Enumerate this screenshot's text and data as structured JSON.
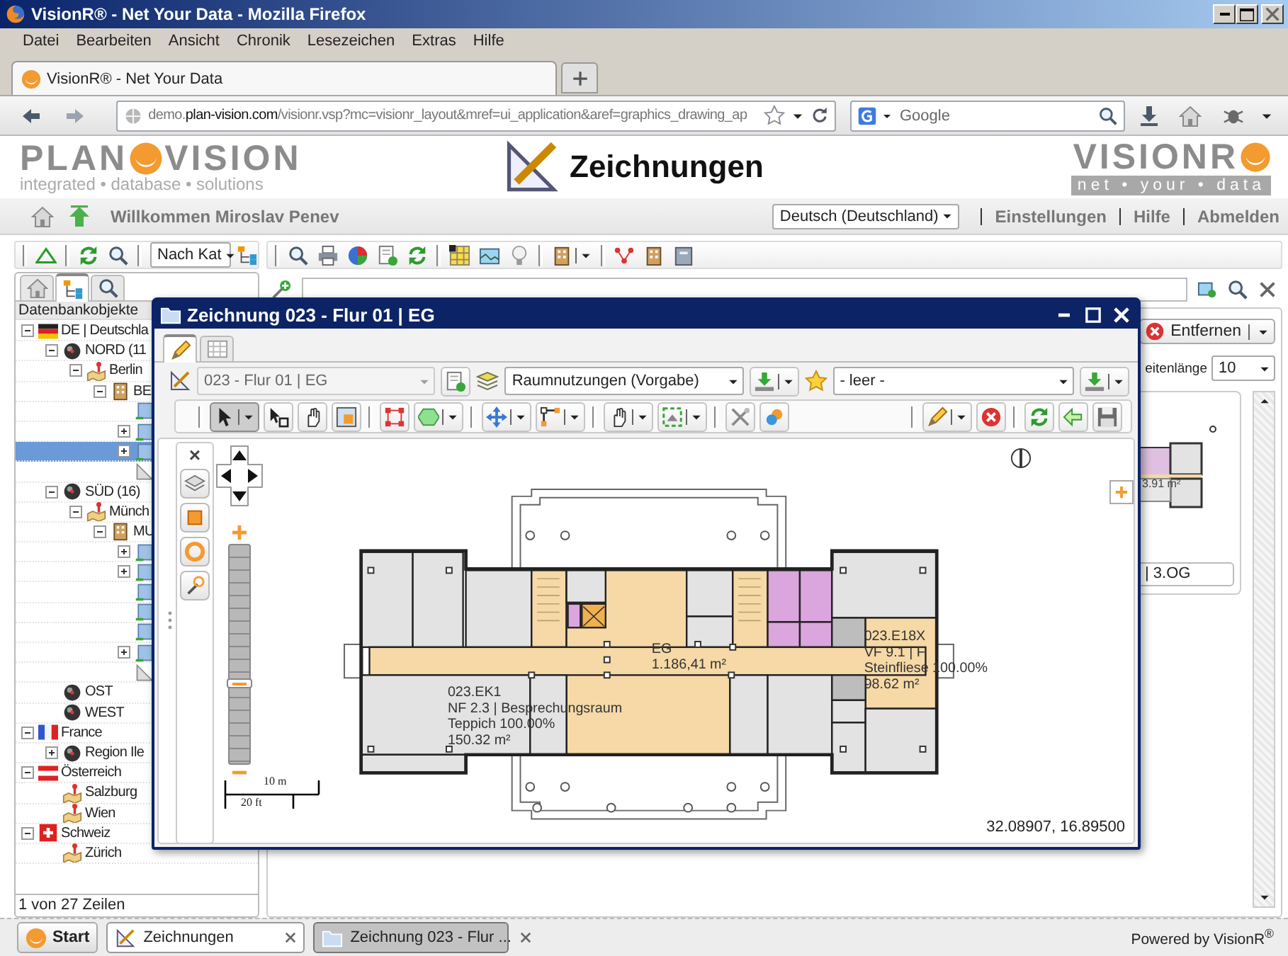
{
  "window": {
    "title": "VisionR® - Net Your Data - Mozilla Firefox"
  },
  "menu": [
    "Datei",
    "Bearbeiten",
    "Ansicht",
    "Chronik",
    "Lesezeichen",
    "Extras",
    "Hilfe"
  ],
  "browser_tabs": [
    {
      "label": "VisionR® - Net Your Data",
      "selected": true
    }
  ],
  "navigation": {
    "back_disabled": false,
    "forward_disabled": true
  },
  "address_bar": {
    "value": "demo.**plan-vision.com**/visionr.vsp?mc=visionr_layout&mref=ui_application&aref=graphics_drawing_ap"
  },
  "search_bar": {
    "placeholder": "Google"
  },
  "app_header": {
    "logo_left": {
      "part1": "PLAN",
      "part2": "VISION",
      "tagline": "integrated • database • solutions"
    },
    "title": "Zeichnungen",
    "logo_right": {
      "name": "VISIONR",
      "tagline": "net • your • data"
    }
  },
  "user_bar": {
    "welcome": "Willkommen Miroslav Penev",
    "language": "Deutsch (Deutschland)",
    "links": [
      "Einstellungen",
      "Hilfe",
      "Abmelden"
    ]
  },
  "left_panel": {
    "filter": "Nach Kat",
    "tabs": [
      {
        "kind": "home",
        "selected": false
      },
      {
        "kind": "tree",
        "selected": true
      },
      {
        "kind": "search",
        "selected": false
      }
    ],
    "header": "Datenbankobjekte",
    "tree": [
      {
        "label": "DE | Deutschla",
        "kind": "flag_de",
        "expanded": true,
        "selected": false,
        "children": [
          {
            "label": "NORD (11",
            "kind": "region",
            "expanded": true,
            "selected": false,
            "children": [
              {
                "label": "Berlin",
                "kind": "city",
                "expanded": true,
                "selected": false,
                "children": [
                  {
                    "label": "BE",
                    "kind": "building",
                    "expanded": true,
                    "selected": false,
                    "children": [
                      {
                        "kind": "floor",
                        "selected": false
                      },
                      {
                        "kind": "floor",
                        "expanded": false,
                        "selected": false
                      },
                      {
                        "kind": "floor",
                        "expanded": false,
                        "selected": true
                      },
                      {
                        "kind": "drawing",
                        "selected": false
                      }
                    ]
                  }
                ]
              }
            ]
          },
          {
            "label": "SÜD (16)",
            "kind": "region",
            "expanded": true,
            "selected": false,
            "children": [
              {
                "label": "Münch",
                "kind": "city",
                "expanded": true,
                "selected": false,
                "children": [
                  {
                    "label": "MU",
                    "kind": "building",
                    "expanded": true,
                    "selected": false,
                    "children": [
                      {
                        "kind": "floor",
                        "expanded": false,
                        "selected": false
                      },
                      {
                        "kind": "floor",
                        "expanded": false,
                        "selected": false
                      },
                      {
                        "kind": "floor",
                        "selected": false
                      },
                      {
                        "kind": "floor",
                        "selected": false
                      },
                      {
                        "kind": "floor",
                        "selected": false
                      },
                      {
                        "kind": "floor",
                        "expanded": false,
                        "selected": false
                      },
                      {
                        "kind": "drawing",
                        "selected": false
                      }
                    ]
                  }
                ]
              }
            ]
          },
          {
            "label": "OST",
            "kind": "region",
            "selected": false
          },
          {
            "label": "WEST",
            "kind": "region",
            "selected": false
          }
        ]
      },
      {
        "label": "France",
        "kind": "flag_fr",
        "expanded": true,
        "selected": false,
        "children": [
          {
            "label": "Region Ile",
            "kind": "region",
            "expanded": false,
            "selected": false
          }
        ]
      },
      {
        "label": "Österreich",
        "kind": "flag_at",
        "expanded": true,
        "selected": false,
        "children": [
          {
            "label": "Salzburg",
            "kind": "city",
            "selected": false
          },
          {
            "label": "Wien",
            "kind": "city",
            "selected": false
          }
        ]
      },
      {
        "label": "Schweiz",
        "kind": "flag_ch",
        "expanded": true,
        "selected": false,
        "children": [
          {
            "label": "Zürich",
            "kind": "city",
            "selected": false
          }
        ]
      }
    ],
    "footer": "1 von 27 Zeilen"
  },
  "right_panel": {
    "remove_button": "Entfernen",
    "page_length_label": "eitenlänge",
    "page_length": "10",
    "thumbnail": {
      "area": "3.91 m²",
      "caption": "| 3.OG"
    }
  },
  "dialog": {
    "title": "Zeichnung 023 - Flur 01 | EG",
    "tabs": [
      {
        "kind": "drawing",
        "selected": true
      },
      {
        "kind": "table",
        "selected": false
      }
    ],
    "drawing_select": {
      "value": "023 - Flur 01 | EG",
      "disabled": true
    },
    "layer_select": {
      "value": "Raumnutzungen (Vorgabe)",
      "disabled": false
    },
    "favorite_select": {
      "value": "- leer -",
      "disabled": false
    },
    "tools_left": [
      {
        "tools": [
          {
            "kind": "pointer",
            "menu": true,
            "selected": true
          },
          {
            "kind": "select_node",
            "menu": false,
            "selected": false
          },
          {
            "kind": "hand",
            "menu": false,
            "selected": false
          },
          {
            "kind": "frame",
            "menu": false,
            "selected": false
          }
        ]
      },
      {
        "tools": [
          {
            "kind": "bbox",
            "menu": false,
            "selected": false
          },
          {
            "kind": "polygon",
            "menu": true,
            "selected": false
          }
        ]
      },
      {
        "tools": [
          {
            "kind": "move",
            "menu": true,
            "selected": false
          },
          {
            "kind": "path",
            "menu": true,
            "selected": false
          }
        ]
      },
      {
        "tools": [
          {
            "kind": "pan",
            "menu": true,
            "selected": false
          },
          {
            "kind": "extent",
            "menu": true,
            "selected": false
          }
        ]
      },
      {
        "tools": [
          {
            "kind": "tools",
            "menu": false,
            "selected": false
          },
          {
            "kind": "merge",
            "menu": false,
            "selected": false
          }
        ]
      }
    ],
    "tools_right": [
      {
        "tools": [
          {
            "kind": "pencil",
            "menu": true,
            "selected": false
          },
          {
            "kind": "delete",
            "menu": false,
            "selected": false
          }
        ]
      },
      {
        "tools": [
          {
            "kind": "refresh",
            "menu": false,
            "selected": false
          },
          {
            "kind": "undo",
            "menu": false,
            "selected": false
          },
          {
            "kind": "save",
            "menu": false,
            "selected": false
          }
        ]
      }
    ],
    "toolbox_close": "×",
    "zoom": {
      "level": 0.37
    },
    "scale": {
      "metric": "10 m",
      "imperial": "20 ft"
    },
    "plan": {
      "labels": [
        {
          "lines": [
            "EG",
            "1.186,41 m²"
          ]
        },
        {
          "lines": [
            "023.EK1",
            "NF 2.3 | Besprechungsraum",
            "Teppich 100.00%",
            "150.32 m²"
          ]
        },
        {
          "lines": [
            "023.E18X",
            "VF 9.1 | F",
            "Steinfliese 100.00%",
            "98.62 m²"
          ]
        }
      ]
    },
    "coordinates": "32.08907, 16.89500"
  },
  "taskbar": {
    "start": "Start",
    "tasks": [
      {
        "label": "Zeichnungen",
        "kind": "drawing",
        "selected": false
      },
      {
        "label": "Zeichnung 023 - Flur ...",
        "kind": "folder",
        "selected": true
      }
    ],
    "powered_by": "Powered by VisionR$^{®}$"
  }
}
